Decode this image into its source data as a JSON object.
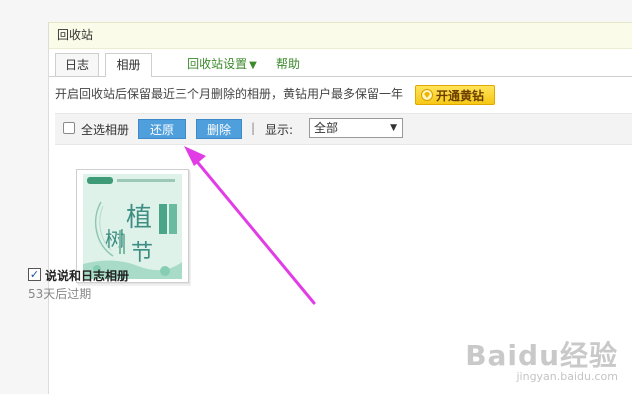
{
  "window": {
    "title": "回收站"
  },
  "tabs": [
    {
      "label": "日志"
    },
    {
      "label": "相册"
    },
    {
      "label": "回收站设置"
    },
    {
      "label": "帮助"
    }
  ],
  "notice": {
    "text": "开启回收站后保留最近三个月删除的相册，黄钻用户最多保留一年",
    "vip_button": "开通黄钻"
  },
  "toolbar": {
    "select_all": "全选相册",
    "restore": "还原",
    "delete": "删除",
    "separator": "|",
    "show_label": "显示:",
    "filter_value": "全部"
  },
  "album": {
    "name": "说说和日志相册",
    "expire": "53天后过期",
    "checked": true,
    "thumb_title": "植树节"
  },
  "watermark": {
    "brand": "Baidu经验",
    "url": "jingyan.baidu.com"
  },
  "colors": {
    "accent_blue": "#4f9fdd",
    "vip_yellow": "#f6c816",
    "annotation_arrow": "#e23ce6",
    "tab_green": "#3a8a2a"
  }
}
